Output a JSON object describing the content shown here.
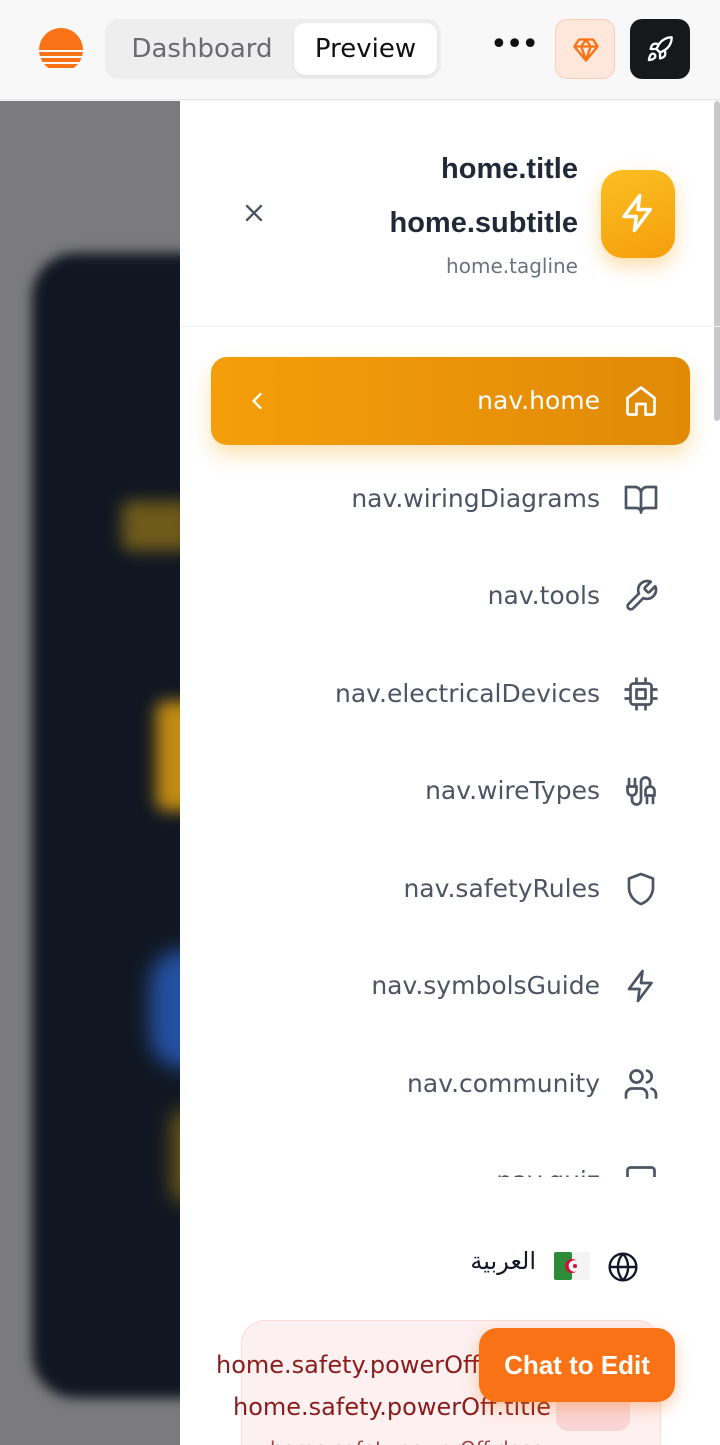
{
  "topbar": {
    "tabs": [
      {
        "label": "Dashboard"
      },
      {
        "label": "Preview"
      }
    ],
    "more_label": "•••",
    "brand_color": "#f97316"
  },
  "drawer": {
    "title": "home.title",
    "subtitle": "home.subtitle",
    "tagline": "home.tagline",
    "nav": [
      {
        "label": "nav.home",
        "icon": "home-icon",
        "active": true
      },
      {
        "label": "nav.wiringDiagrams",
        "icon": "book-icon"
      },
      {
        "label": "nav.tools",
        "icon": "wrench-icon"
      },
      {
        "label": "nav.electricalDevices",
        "icon": "cpu-icon"
      },
      {
        "label": "nav.wireTypes",
        "icon": "cable-icon"
      },
      {
        "label": "nav.safetyRules",
        "icon": "shield-icon"
      },
      {
        "label": "nav.symbolsGuide",
        "icon": "bolt-icon"
      },
      {
        "label": "nav.community",
        "icon": "users-icon"
      },
      {
        "label": "nav.quiz",
        "icon": "monitor-icon"
      }
    ],
    "language": {
      "label": "العربية",
      "flag": "algeria-flag",
      "icon": "globe-icon"
    },
    "safety": {
      "line1": "home.safety.powerOff.e",
      "title": "home.safety.powerOff.title",
      "desc": "home.safety.powerOff.desc"
    },
    "accent_color": "#f59e0b"
  },
  "chat_button": {
    "label": "Chat to Edit"
  }
}
